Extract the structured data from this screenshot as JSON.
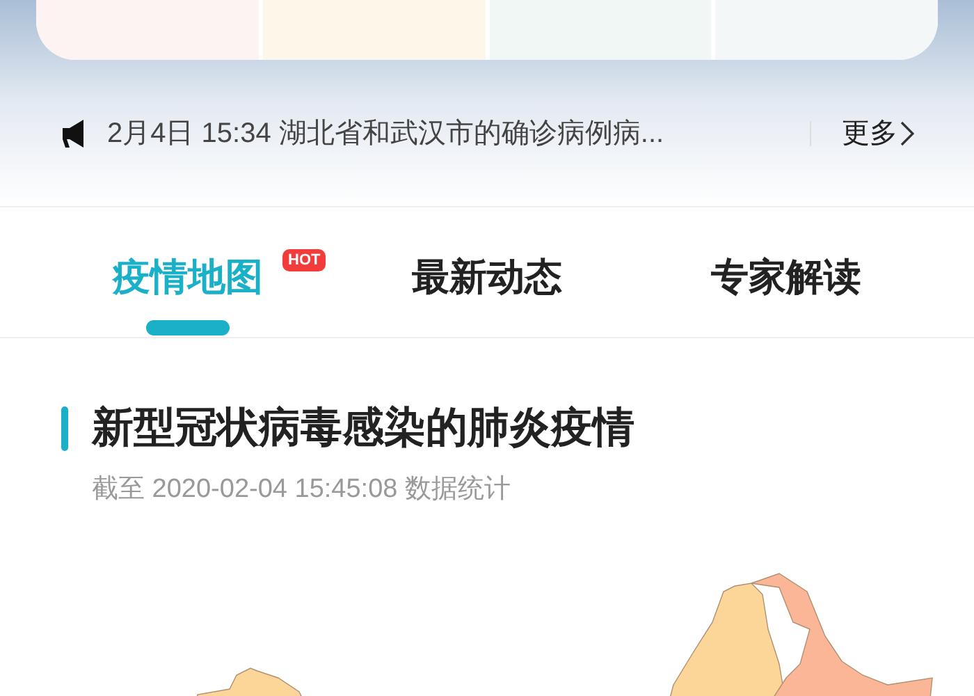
{
  "notice": {
    "text": "2月4日 15:34 湖北省和武汉市的确诊病例病...",
    "more": "更多"
  },
  "tabs": [
    {
      "label": "疫情地图",
      "selected": true,
      "badge": "HOT"
    },
    {
      "label": "最新动态",
      "selected": false
    },
    {
      "label": "专家解读",
      "selected": false
    }
  ],
  "section": {
    "title": "新型冠状病毒感染的肺炎疫情",
    "subtitle": "截至 2020-02-04 15:45:08 数据统计"
  }
}
